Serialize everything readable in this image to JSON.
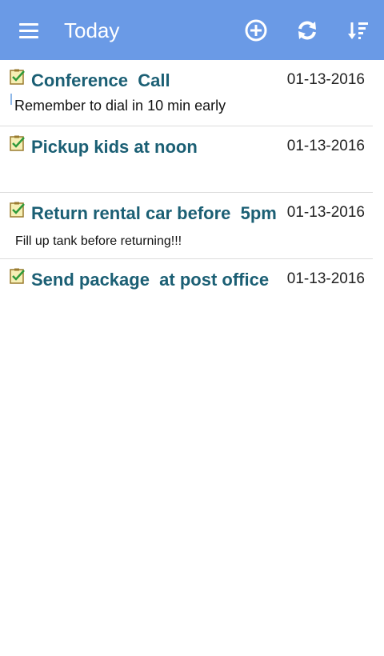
{
  "appbar": {
    "title": "Today",
    "color": "#6a9ae6",
    "icons": [
      "menu-icon",
      "add-circle-icon",
      "refresh-icon",
      "sort-icon"
    ]
  },
  "tasks": [
    {
      "title": "Conference  Call",
      "date": "01-13-2016",
      "note": "Remember to dial in 10 min early"
    },
    {
      "title": "Pickup kids at noon",
      "date": "01-13-2016",
      "note": ""
    },
    {
      "title": "Return rental car before  5pm",
      "date": "01-13-2016",
      "note": "Fill up tank before returning!!!"
    },
    {
      "title": "Send package  at post office",
      "date": "01-13-2016",
      "note": ""
    }
  ],
  "colors": {
    "title_text": "#1b5f74",
    "divider": "#dcdcdc"
  }
}
